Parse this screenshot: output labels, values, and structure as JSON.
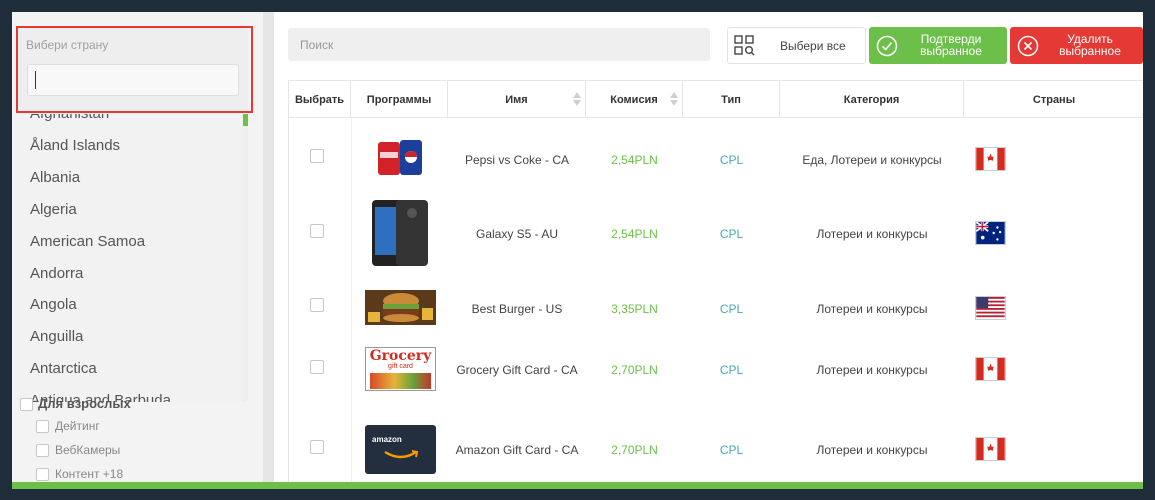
{
  "sidebar": {
    "country_label": "Вибери страну",
    "countries": [
      "Afghanistan",
      "Åland Islands",
      "Albania",
      "Algeria",
      "American Samoa",
      "Andorra",
      "Angola",
      "Anguilla",
      "Antarctica",
      "Antigua and Barbuda"
    ],
    "category_heading": "Для взрослых",
    "subcategories": [
      "Дейтинг",
      "ВебКамеры",
      "Контент +18"
    ]
  },
  "toolbar": {
    "search_placeholder": "Поиск",
    "select_all": "Выбери все",
    "confirm_line1": "Подтверди",
    "confirm_line2": "выбранное",
    "delete_line1": "Удалить",
    "delete_line2": "выбранное"
  },
  "table": {
    "columns": [
      "Выбрать",
      "Программы",
      "Имя",
      "Комисия",
      "Тип",
      "Категория",
      "Страны"
    ],
    "rows": [
      {
        "name": "Pepsi vs Coke - CA",
        "commission": "2,54PLN",
        "type": "CPL",
        "category": "Еда,  Лотереи и конкурсы",
        "flag": "canada-flag-icon",
        "thumb": "cola-cans-thumbnail"
      },
      {
        "name": "Galaxy S5 - AU",
        "commission": "2,54PLN",
        "type": "CPL",
        "category": "Лотереи и конкурсы",
        "flag": "australia-flag-icon",
        "thumb": "phone-thumbnail"
      },
      {
        "name": "Best Burger - US",
        "commission": "3,35PLN",
        "type": "CPL",
        "category": "Лотереи и конкурсы",
        "flag": "usa-flag-icon",
        "thumb": "burger-thumbnail"
      },
      {
        "name": "Grocery Gift Card - CA",
        "commission": "2,70PLN",
        "type": "CPL",
        "category": "Лотереи и конкурсы",
        "flag": "canada-flag-icon",
        "thumb": "grocery-card-thumbnail",
        "thumb_title": "Grocery",
        "thumb_subtitle": "gift card"
      },
      {
        "name": "Amazon Gift Card - CA",
        "commission": "2,70PLN",
        "type": "CPL",
        "category": "Лотереи и конкурсы",
        "flag": "canada-flag-icon",
        "thumb": "amazon-card-thumbnail",
        "thumb_title": "amazon"
      }
    ]
  },
  "colors": {
    "accent_green": "#6cc04a",
    "danger_red": "#e53935",
    "type_teal": "#4aa8b8"
  }
}
